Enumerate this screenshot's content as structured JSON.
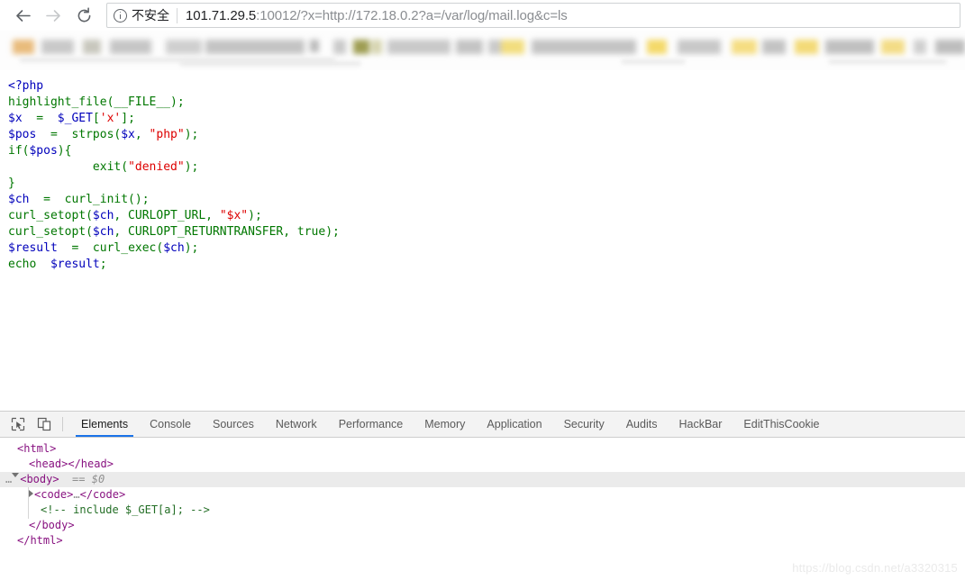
{
  "browser": {
    "nav": {
      "back_label": "Back",
      "forward_label": "Forward",
      "reload_label": "Reload"
    },
    "omnibox": {
      "security_label": "不安全",
      "url_host": "101.71.29.5",
      "url_rest": ":10012/?x=http://172.18.0.2?a=/var/log/mail.log&c=ls",
      "full_url": "101.71.29.5:10012/?x=http://172.18.0.2?a=/var/log/mail.log&c=ls"
    },
    "bookmarks_bar": {
      "note": "redacted"
    }
  },
  "page": {
    "code_lines": [
      [
        {
          "t": "<?php",
          "c": "default"
        }
      ],
      [
        {
          "t": "highlight_file(__FILE__);",
          "c": "kw"
        }
      ],
      [
        {
          "t": "$x",
          "c": "var"
        },
        {
          "t": "  =  ",
          "c": "kw"
        },
        {
          "t": "$_GET",
          "c": "var"
        },
        {
          "t": "[",
          "c": "kw"
        },
        {
          "t": "'x'",
          "c": "str"
        },
        {
          "t": "];",
          "c": "kw"
        }
      ],
      [
        {
          "t": "$pos",
          "c": "var"
        },
        {
          "t": "  =  strpos(",
          "c": "kw"
        },
        {
          "t": "$x",
          "c": "var"
        },
        {
          "t": ", ",
          "c": "kw"
        },
        {
          "t": "\"php\"",
          "c": "str"
        },
        {
          "t": ");",
          "c": "kw"
        }
      ],
      [
        {
          "t": "if(",
          "c": "kw"
        },
        {
          "t": "$pos",
          "c": "var"
        },
        {
          "t": "){",
          "c": "kw"
        }
      ],
      [
        {
          "t": "            exit(",
          "c": "kw"
        },
        {
          "t": "\"denied\"",
          "c": "str"
        },
        {
          "t": ");",
          "c": "kw"
        }
      ],
      [
        {
          "t": "}",
          "c": "kw"
        }
      ],
      [
        {
          "t": "$ch",
          "c": "var"
        },
        {
          "t": "  =  curl_init();",
          "c": "kw"
        }
      ],
      [
        {
          "t": "curl_setopt(",
          "c": "kw"
        },
        {
          "t": "$ch",
          "c": "var"
        },
        {
          "t": ", CURLOPT_URL, ",
          "c": "kw"
        },
        {
          "t": "\"$x\"",
          "c": "str"
        },
        {
          "t": ");",
          "c": "kw"
        }
      ],
      [
        {
          "t": "curl_setopt(",
          "c": "kw"
        },
        {
          "t": "$ch",
          "c": "var"
        },
        {
          "t": ", CURLOPT_RETURNTRANSFER, true);",
          "c": "kw"
        }
      ],
      [
        {
          "t": "$result",
          "c": "var"
        },
        {
          "t": "  =  curl_exec(",
          "c": "kw"
        },
        {
          "t": "$ch",
          "c": "var"
        },
        {
          "t": ");",
          "c": "kw"
        }
      ],
      [
        {
          "t": "echo",
          "c": "kw"
        },
        {
          "t": "  ",
          "c": "kw"
        },
        {
          "t": "$result",
          "c": "var"
        },
        {
          "t": ";",
          "c": "kw"
        }
      ]
    ],
    "code_plain": "<?php\nhighlight_file(__FILE__);\n$x  =  $_GET['x'];\n$pos  =  strpos($x, \"php\");\nif($pos){\n            exit(\"denied\");\n}\n$ch  =  curl_init();\ncurl_setopt($ch, CURLOPT_URL, \"$x\");\ncurl_setopt($ch, CURLOPT_RETURNTRANSFER, true);\n$result  =  curl_exec($ch);\necho  $result;"
  },
  "devtools": {
    "tools": {
      "inspect_label": "Inspect element",
      "device_toolbar_label": "Toggle device toolbar"
    },
    "tabs": [
      {
        "label": "Elements",
        "active": true
      },
      {
        "label": "Console",
        "active": false
      },
      {
        "label": "Sources",
        "active": false
      },
      {
        "label": "Network",
        "active": false
      },
      {
        "label": "Performance",
        "active": false
      },
      {
        "label": "Memory",
        "active": false
      },
      {
        "label": "Application",
        "active": false
      },
      {
        "label": "Security",
        "active": false
      },
      {
        "label": "Audits",
        "active": false
      },
      {
        "label": "HackBar",
        "active": false
      },
      {
        "label": "EditThisCookie",
        "active": false
      }
    ],
    "dom_rows": [
      {
        "indent": 1,
        "html": "<span class=\"tag\">&lt;html&gt;</span>",
        "selected": false
      },
      {
        "indent": 2,
        "html": "<span class=\"tag\">&lt;head&gt;&lt;/head&gt;</span>",
        "selected": false
      },
      {
        "indent": 0,
        "html": "<span class=\"ellipsis-pre\">…</span><span class=\"triangle down\"></span><span class=\"tag\">&lt;body&gt;</span><span class=\"punc\">  == </span><span class=\"sel-marker\">$0</span>",
        "selected": true
      },
      {
        "indent": 2,
        "html": "<span class=\"triangle\"></span><span class=\"tag\">&lt;code&gt;</span><span class=\"punc\">…</span><span class=\"tag\">&lt;/code&gt;</span>",
        "selected": false
      },
      {
        "indent": 3,
        "html": "<span class=\"comment\">&lt;!-- include $_GET[a]; --&gt;</span>",
        "selected": false
      },
      {
        "indent": 2,
        "html": "<span class=\"tag\">&lt;/body&gt;</span>",
        "selected": false
      },
      {
        "indent": 1,
        "html": "<span class=\"tag\">&lt;/html&gt;</span>",
        "selected": false
      }
    ],
    "dom_rows_text": [
      "<html>",
      "<head></head>",
      "…<body>  == $0",
      "<code>…</code>",
      "<!-- include $_GET[a]; -->",
      "</body>",
      "</html>"
    ]
  },
  "watermark": {
    "text": "https://blog.csdn.net/a3320315"
  },
  "colors": {
    "accent": "#1a73e8",
    "php_default": "#0000bb",
    "php_keyword": "#007700",
    "php_string": "#dd0000",
    "dom_tag": "#881280",
    "dom_comment": "#236e25"
  }
}
